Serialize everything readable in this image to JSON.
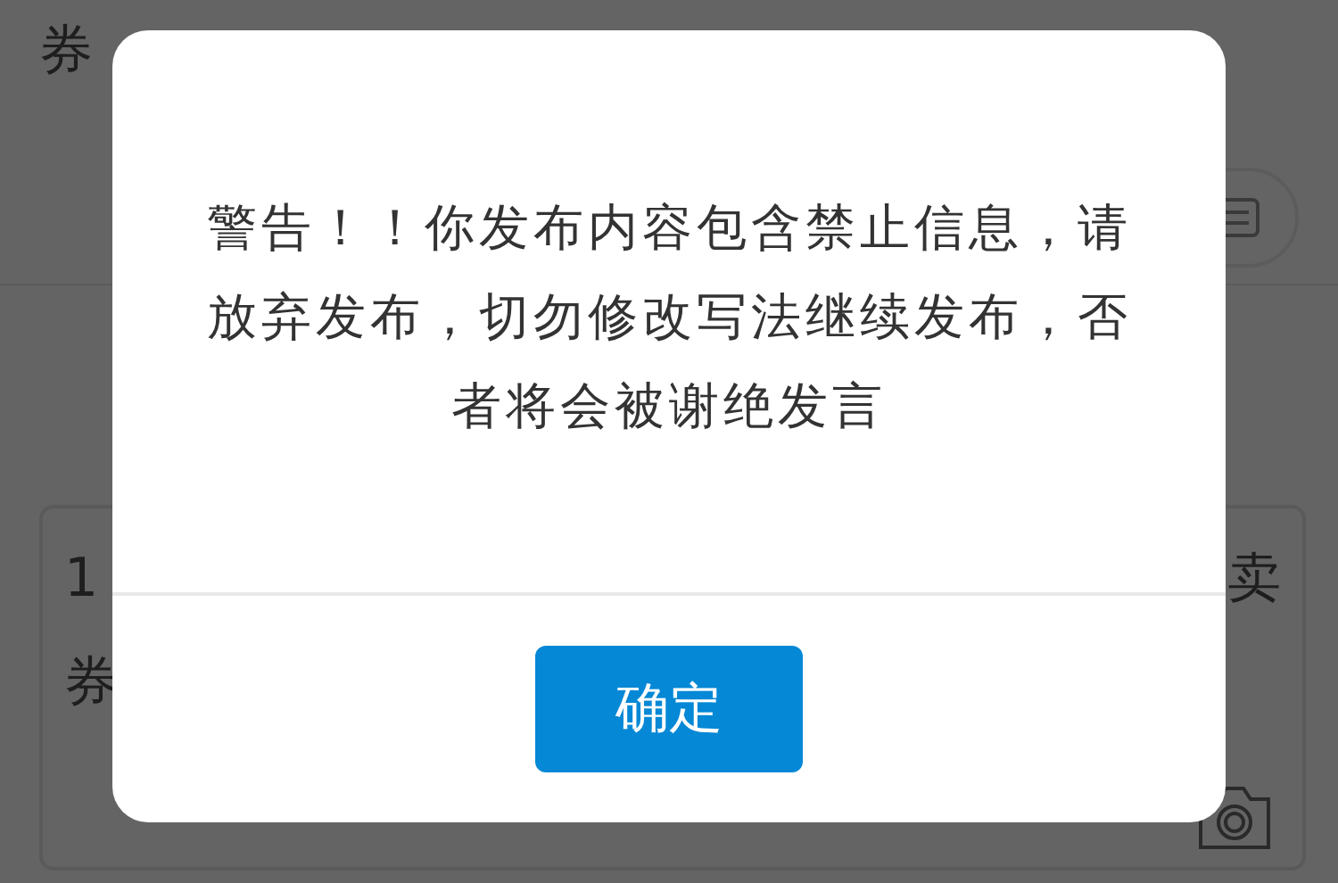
{
  "page": {
    "heading_fragment": "券",
    "textarea_lines": [
      {
        "start": "1",
        "end": "卖"
      },
      {
        "start": "券"
      }
    ]
  },
  "dialog": {
    "message": "警告！！你发布内容包含禁止信息，请放弃发布，切勿修改写法继续发布，否者将会被谢绝发言",
    "button": "确定"
  }
}
